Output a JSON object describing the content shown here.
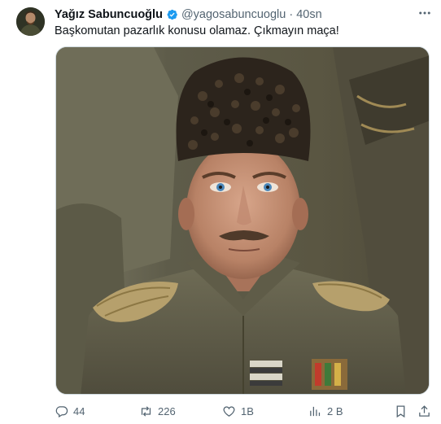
{
  "author": {
    "display_name": "Yağız Sabuncuoğlu",
    "handle": "@yagosabuncuoglu",
    "separator": "·",
    "timestamp": "40sn"
  },
  "tweet": {
    "text": "Başkomutan pazarlık konusu olamaz. Çıkmayın maça!"
  },
  "actions": {
    "replies": "44",
    "reposts": "226",
    "likes": "1B",
    "views": "2 B"
  },
  "colors": {
    "verified": "#1d9bf0",
    "secondary_text": "#536471",
    "primary_text": "#0f1419"
  },
  "icons": [
    "verified-badge-icon",
    "more-icon",
    "reply-icon",
    "repost-icon",
    "like-icon",
    "views-icon",
    "bookmark-icon",
    "share-icon"
  ]
}
